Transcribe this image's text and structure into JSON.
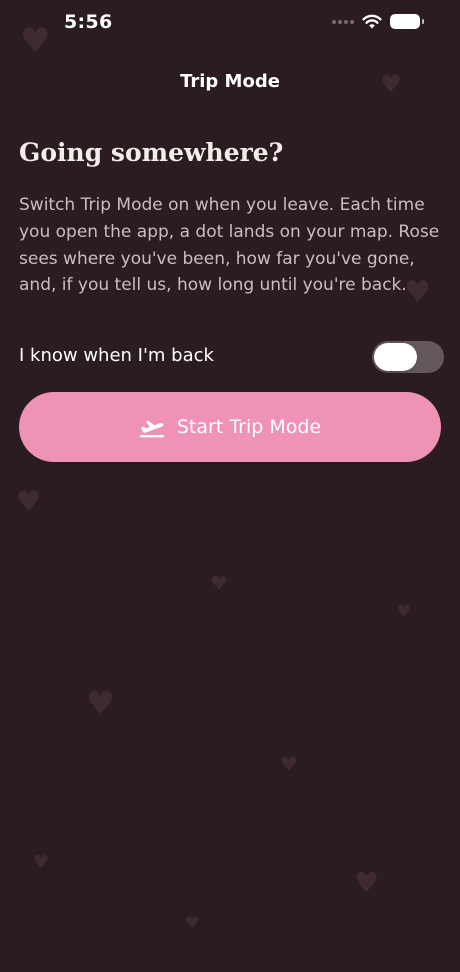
{
  "status_bar": {
    "time": "5:56",
    "icons": [
      "cellular-signal-icon",
      "wifi-icon",
      "battery-icon"
    ]
  },
  "nav": {
    "title": "Trip Mode"
  },
  "content": {
    "headline": "Going somewhere?",
    "description": "Switch Trip Mode on when you leave. Each time you open the app, a dot lands on your map. Rose sees where you've been, how far you've gone, and, if you tell us, how long until you're back.",
    "return_toggle": {
      "label": "I know when I'm back",
      "on": false
    },
    "start_button": {
      "label": "Start Trip Mode",
      "icon": "airplane-takeoff-icon"
    }
  },
  "colors": {
    "background": "#2b1c21",
    "accent": "#ef93b6",
    "toggle_off": "#64585c",
    "decor_hearts": "#3e2a30"
  }
}
